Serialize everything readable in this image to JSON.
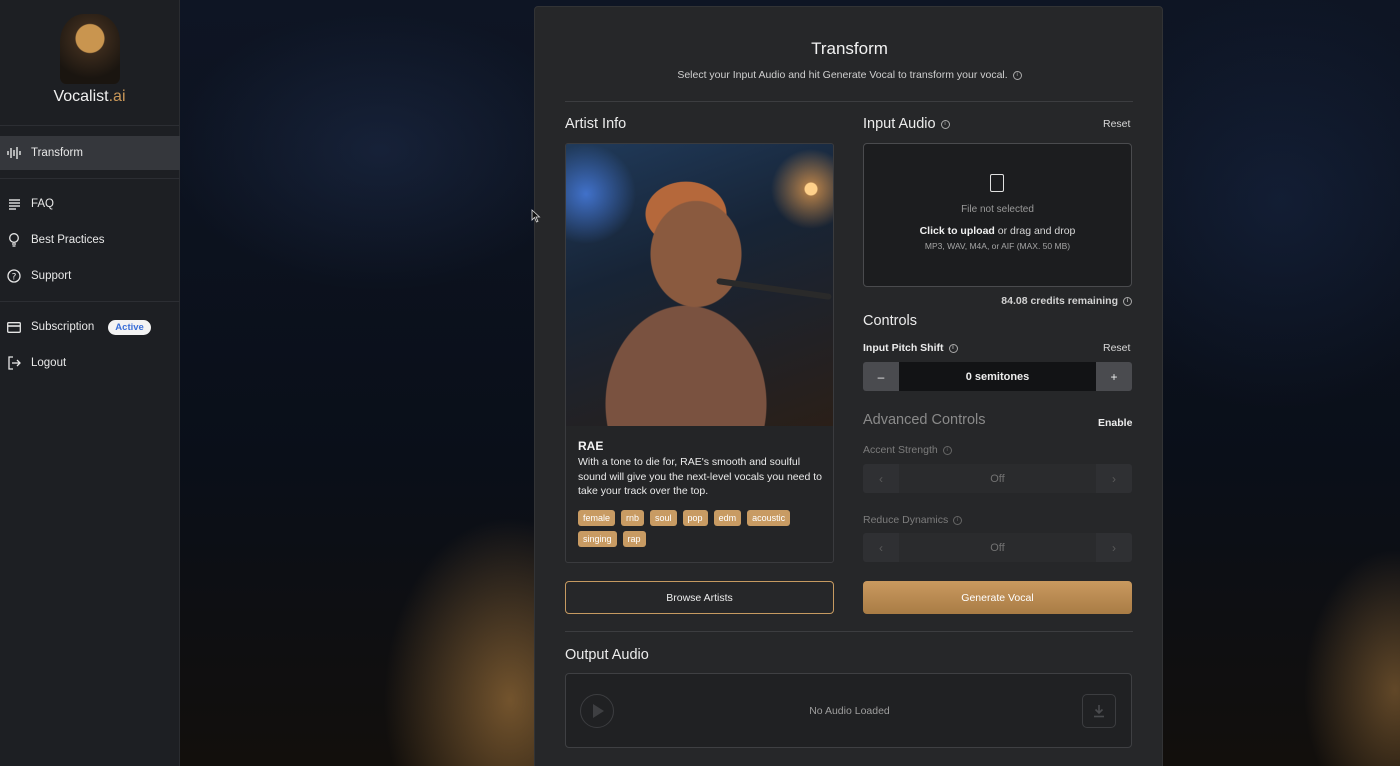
{
  "brand": {
    "name": "Vocalist",
    "suffix": ".ai"
  },
  "sidebar": {
    "items": [
      {
        "label": "Transform",
        "icon": "waveform-icon"
      },
      {
        "label": "FAQ",
        "icon": "list-icon"
      },
      {
        "label": "Best Practices",
        "icon": "lightbulb-icon"
      },
      {
        "label": "Support",
        "icon": "question-icon"
      },
      {
        "label": "Subscription",
        "icon": "credit-card-icon",
        "badge": "Active"
      },
      {
        "label": "Logout",
        "icon": "logout-icon"
      }
    ]
  },
  "transform": {
    "title": "Transform",
    "subtitle": "Select your Input Audio and hit Generate Vocal to transform your vocal."
  },
  "artist": {
    "heading": "Artist Info",
    "name": "RAE",
    "description": "With a tone to die for, RAE's smooth and soulful sound will give you the next-level vocals you need to take your track over the top.",
    "tags": [
      "female",
      "rnb",
      "soul",
      "pop",
      "edm",
      "acoustic",
      "singing",
      "rap"
    ],
    "browse_label": "Browse Artists"
  },
  "input_audio": {
    "heading": "Input Audio",
    "reset_label": "Reset",
    "status": "File not selected",
    "upload_bold": "Click to upload",
    "upload_rest": " or drag and drop",
    "formats": "MP3, WAV, M4A, or AIF (MAX. 50 MB)",
    "credits": "84.08 credits remaining"
  },
  "controls": {
    "heading": "Controls",
    "pitch_label": "Input Pitch Shift",
    "pitch_reset": "Reset",
    "pitch_value": "0 semitones",
    "minus": "–",
    "plus": "+"
  },
  "advanced": {
    "heading": "Advanced Controls",
    "enable_label": "Enable",
    "accent_label": "Accent Strength",
    "accent_value": "Off",
    "dynamics_label": "Reduce Dynamics",
    "dynamics_value": "Off",
    "left_arrow": "‹",
    "right_arrow": "›"
  },
  "generate_label": "Generate Vocal",
  "output": {
    "heading": "Output Audio",
    "status": "No Audio Loaded"
  },
  "colors": {
    "accent": "#c89b63",
    "panel": "#262729",
    "sidebar": "#1d1f23"
  }
}
